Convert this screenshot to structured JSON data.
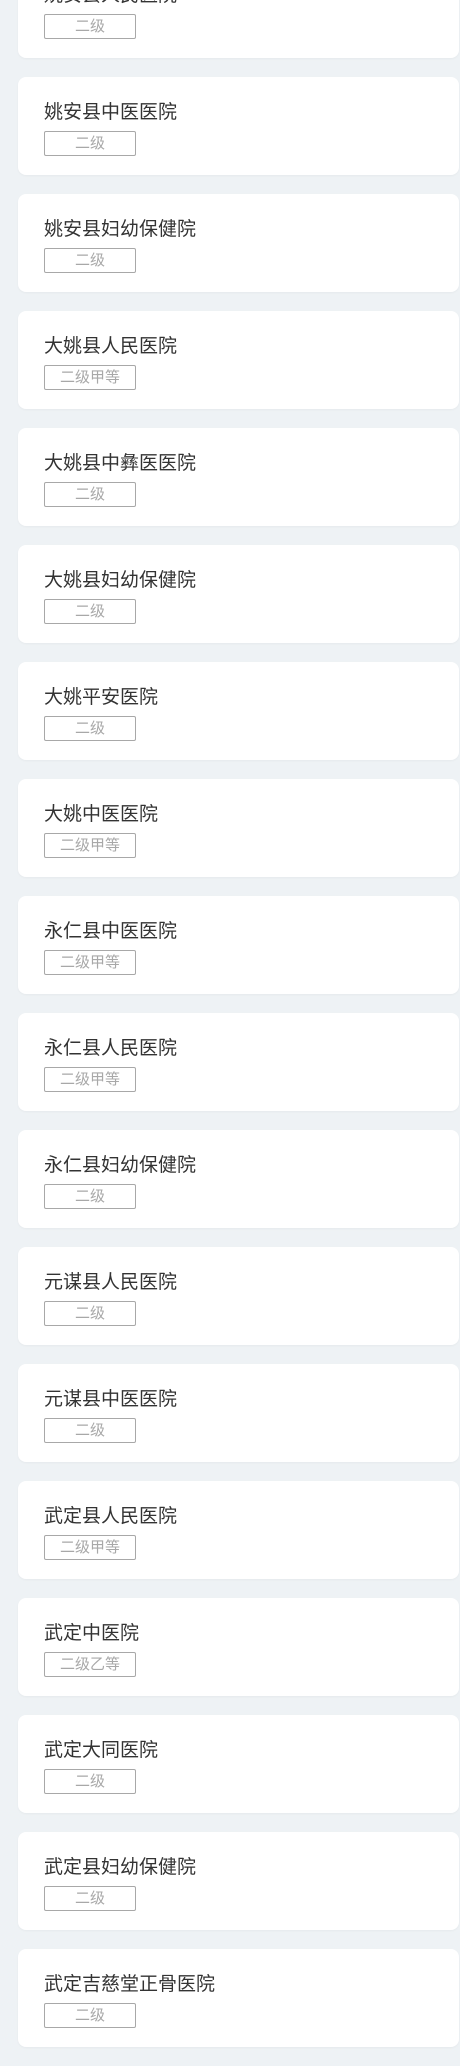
{
  "hospitals": [
    {
      "name": "姚安县人民医院",
      "level": "二级"
    },
    {
      "name": "姚安县中医医院",
      "level": "二级"
    },
    {
      "name": "姚安县妇幼保健院",
      "level": "二级"
    },
    {
      "name": "大姚县人民医院",
      "level": "二级甲等"
    },
    {
      "name": "大姚县中彝医医院",
      "level": "二级"
    },
    {
      "name": "大姚县妇幼保健院",
      "level": "二级"
    },
    {
      "name": "大姚平安医院",
      "level": "二级"
    },
    {
      "name": "大姚中医医院",
      "level": "二级甲等"
    },
    {
      "name": "永仁县中医医院",
      "level": "二级甲等"
    },
    {
      "name": "永仁县人民医院",
      "level": "二级甲等"
    },
    {
      "name": "永仁县妇幼保健院",
      "level": "二级"
    },
    {
      "name": "元谋县人民医院",
      "level": "二级"
    },
    {
      "name": "元谋县中医医院",
      "level": "二级"
    },
    {
      "name": "武定县人民医院",
      "level": "二级甲等"
    },
    {
      "name": "武定中医院",
      "level": "二级乙等"
    },
    {
      "name": "武定大同医院",
      "level": "二级"
    },
    {
      "name": "武定县妇幼保健院",
      "level": "二级"
    },
    {
      "name": "武定吉慈堂正骨医院",
      "level": "二级"
    }
  ]
}
